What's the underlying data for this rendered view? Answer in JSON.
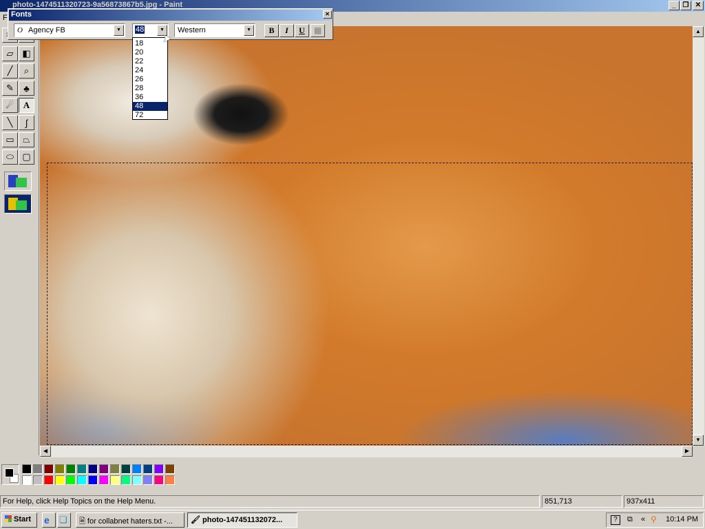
{
  "window": {
    "title": "photo-1474511320723-9a56873867b5.jpg - Paint",
    "menu_first": "F"
  },
  "fonts_toolbar": {
    "title": "Fonts",
    "font_name": "Agency FB",
    "font_size": "48",
    "script": "Western",
    "bold_label": "B",
    "italic_label": "I",
    "underline_label": "U",
    "size_options": [
      "18",
      "20",
      "22",
      "24",
      "26",
      "28",
      "36",
      "48",
      "72"
    ],
    "selected_size": "48"
  },
  "tools": [
    {
      "name": "free-select-icon"
    },
    {
      "name": "select-icon"
    },
    {
      "name": "eraser-icon"
    },
    {
      "name": "fill-bucket-icon"
    },
    {
      "name": "color-picker-icon"
    },
    {
      "name": "magnifier-icon"
    },
    {
      "name": "pencil-icon"
    },
    {
      "name": "brush-icon"
    },
    {
      "name": "airbrush-icon"
    },
    {
      "name": "text-icon",
      "pressed": true
    },
    {
      "name": "line-icon"
    },
    {
      "name": "curve-icon"
    },
    {
      "name": "rectangle-icon"
    },
    {
      "name": "polygon-icon"
    },
    {
      "name": "ellipse-icon"
    },
    {
      "name": "rounded-rect-icon"
    }
  ],
  "palette": {
    "foreground": "#000000",
    "background": "#ffffff",
    "row1": [
      "#000000",
      "#808080",
      "#800000",
      "#808000",
      "#008000",
      "#008080",
      "#000080",
      "#800080",
      "#808040",
      "#004040",
      "#0080ff",
      "#004080",
      "#8000ff",
      "#804000"
    ],
    "row2": [
      "#ffffff",
      "#c0c0c0",
      "#ff0000",
      "#ffff00",
      "#00ff00",
      "#00ffff",
      "#0000ff",
      "#ff00ff",
      "#ffff80",
      "#00ff80",
      "#80ffff",
      "#8080ff",
      "#ff0080",
      "#ff8040"
    ]
  },
  "status": {
    "help": "For Help, click Help Topics on the Help Menu.",
    "coords": "851,713",
    "size": "937x411"
  },
  "taskbar": {
    "start": "Start",
    "task1": "for collabnet haters.txt -...",
    "task2": "photo-147451132072...",
    "time": "10:14 PM"
  }
}
